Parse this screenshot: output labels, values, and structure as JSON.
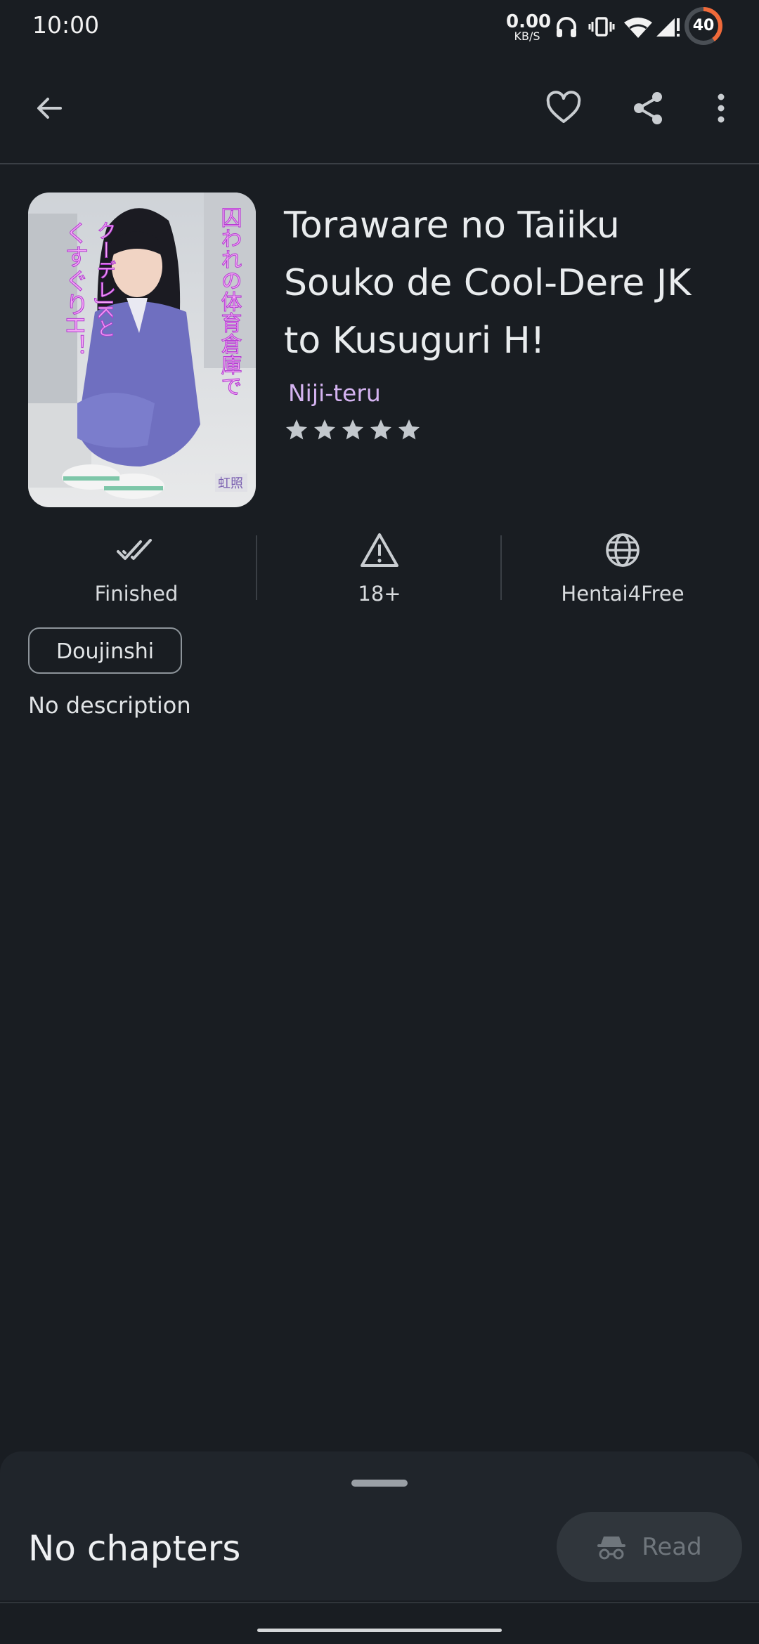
{
  "status_bar": {
    "time": "10:00",
    "speed_value": "0.00",
    "speed_unit": "KB/S",
    "battery": "40"
  },
  "toolbar": {
    "back_icon": "arrow-left-icon",
    "favorite_icon": "heart-outline-icon",
    "share_icon": "share-icon",
    "more_icon": "more-vertical-icon"
  },
  "manga": {
    "title": "Toraware no Taiiku Souko de Cool-Dere JK to Kusuguri H!",
    "author": "Niji-teru",
    "rating_stars": 5,
    "cover_text": "囚われの体育倉庫で クーデレJKとくすぐりH！",
    "cover_circle_text": "虹照"
  },
  "info": {
    "status": "Finished",
    "age_rating": "18+",
    "source": "Hentai4Free"
  },
  "genres": [
    "Doujinshi"
  ],
  "description": "No description",
  "sheet": {
    "empty_label": "No chapters",
    "read_label": "Read"
  },
  "colors": {
    "background": "#191d22",
    "author": "#d4b3f0",
    "battery_accent": "#f06a3a"
  }
}
